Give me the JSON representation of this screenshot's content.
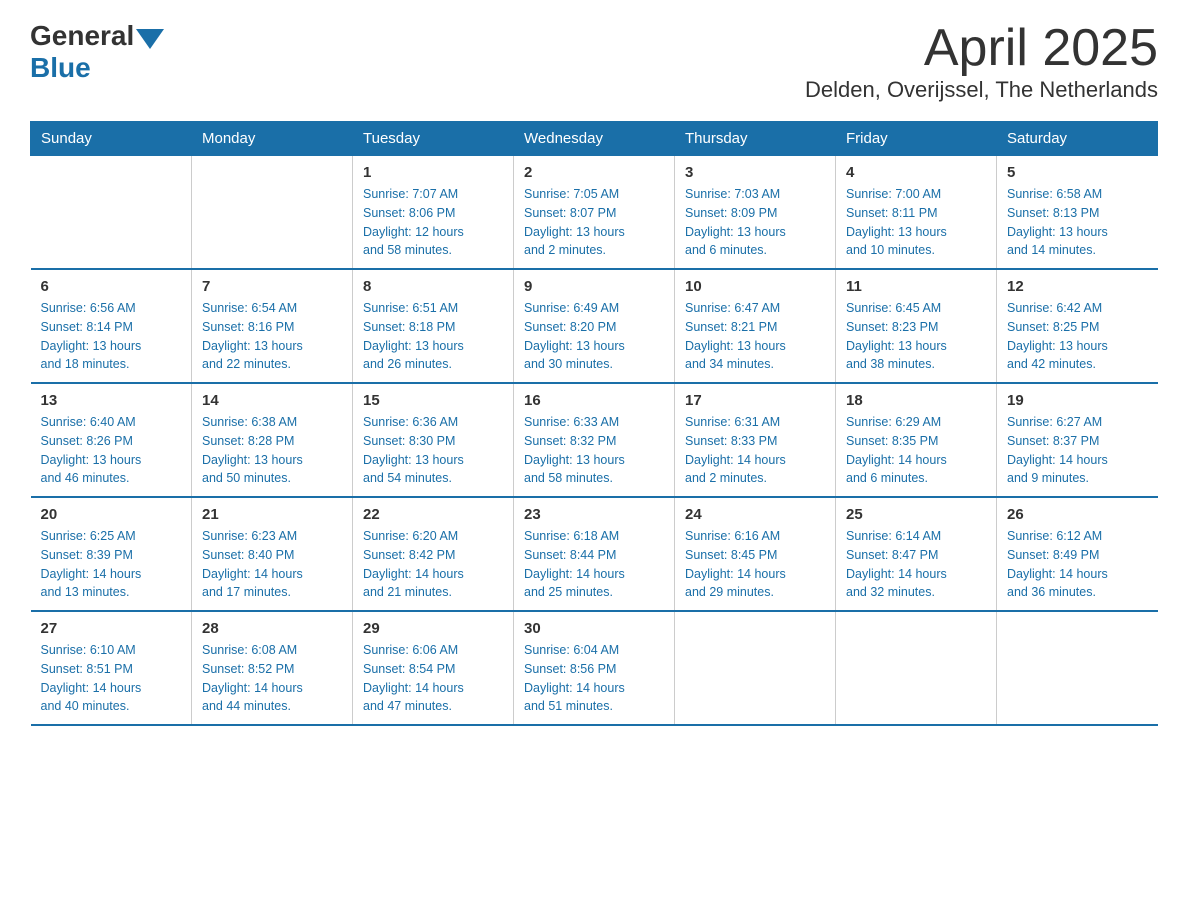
{
  "logo": {
    "general": "General",
    "blue": "Blue"
  },
  "title": "April 2025",
  "subtitle": "Delden, Overijssel, The Netherlands",
  "calendar": {
    "headers": [
      "Sunday",
      "Monday",
      "Tuesday",
      "Wednesday",
      "Thursday",
      "Friday",
      "Saturday"
    ],
    "weeks": [
      [
        {
          "day": "",
          "info": ""
        },
        {
          "day": "",
          "info": ""
        },
        {
          "day": "1",
          "info": "Sunrise: 7:07 AM\nSunset: 8:06 PM\nDaylight: 12 hours\nand 58 minutes."
        },
        {
          "day": "2",
          "info": "Sunrise: 7:05 AM\nSunset: 8:07 PM\nDaylight: 13 hours\nand 2 minutes."
        },
        {
          "day": "3",
          "info": "Sunrise: 7:03 AM\nSunset: 8:09 PM\nDaylight: 13 hours\nand 6 minutes."
        },
        {
          "day": "4",
          "info": "Sunrise: 7:00 AM\nSunset: 8:11 PM\nDaylight: 13 hours\nand 10 minutes."
        },
        {
          "day": "5",
          "info": "Sunrise: 6:58 AM\nSunset: 8:13 PM\nDaylight: 13 hours\nand 14 minutes."
        }
      ],
      [
        {
          "day": "6",
          "info": "Sunrise: 6:56 AM\nSunset: 8:14 PM\nDaylight: 13 hours\nand 18 minutes."
        },
        {
          "day": "7",
          "info": "Sunrise: 6:54 AM\nSunset: 8:16 PM\nDaylight: 13 hours\nand 22 minutes."
        },
        {
          "day": "8",
          "info": "Sunrise: 6:51 AM\nSunset: 8:18 PM\nDaylight: 13 hours\nand 26 minutes."
        },
        {
          "day": "9",
          "info": "Sunrise: 6:49 AM\nSunset: 8:20 PM\nDaylight: 13 hours\nand 30 minutes."
        },
        {
          "day": "10",
          "info": "Sunrise: 6:47 AM\nSunset: 8:21 PM\nDaylight: 13 hours\nand 34 minutes."
        },
        {
          "day": "11",
          "info": "Sunrise: 6:45 AM\nSunset: 8:23 PM\nDaylight: 13 hours\nand 38 minutes."
        },
        {
          "day": "12",
          "info": "Sunrise: 6:42 AM\nSunset: 8:25 PM\nDaylight: 13 hours\nand 42 minutes."
        }
      ],
      [
        {
          "day": "13",
          "info": "Sunrise: 6:40 AM\nSunset: 8:26 PM\nDaylight: 13 hours\nand 46 minutes."
        },
        {
          "day": "14",
          "info": "Sunrise: 6:38 AM\nSunset: 8:28 PM\nDaylight: 13 hours\nand 50 minutes."
        },
        {
          "day": "15",
          "info": "Sunrise: 6:36 AM\nSunset: 8:30 PM\nDaylight: 13 hours\nand 54 minutes."
        },
        {
          "day": "16",
          "info": "Sunrise: 6:33 AM\nSunset: 8:32 PM\nDaylight: 13 hours\nand 58 minutes."
        },
        {
          "day": "17",
          "info": "Sunrise: 6:31 AM\nSunset: 8:33 PM\nDaylight: 14 hours\nand 2 minutes."
        },
        {
          "day": "18",
          "info": "Sunrise: 6:29 AM\nSunset: 8:35 PM\nDaylight: 14 hours\nand 6 minutes."
        },
        {
          "day": "19",
          "info": "Sunrise: 6:27 AM\nSunset: 8:37 PM\nDaylight: 14 hours\nand 9 minutes."
        }
      ],
      [
        {
          "day": "20",
          "info": "Sunrise: 6:25 AM\nSunset: 8:39 PM\nDaylight: 14 hours\nand 13 minutes."
        },
        {
          "day": "21",
          "info": "Sunrise: 6:23 AM\nSunset: 8:40 PM\nDaylight: 14 hours\nand 17 minutes."
        },
        {
          "day": "22",
          "info": "Sunrise: 6:20 AM\nSunset: 8:42 PM\nDaylight: 14 hours\nand 21 minutes."
        },
        {
          "day": "23",
          "info": "Sunrise: 6:18 AM\nSunset: 8:44 PM\nDaylight: 14 hours\nand 25 minutes."
        },
        {
          "day": "24",
          "info": "Sunrise: 6:16 AM\nSunset: 8:45 PM\nDaylight: 14 hours\nand 29 minutes."
        },
        {
          "day": "25",
          "info": "Sunrise: 6:14 AM\nSunset: 8:47 PM\nDaylight: 14 hours\nand 32 minutes."
        },
        {
          "day": "26",
          "info": "Sunrise: 6:12 AM\nSunset: 8:49 PM\nDaylight: 14 hours\nand 36 minutes."
        }
      ],
      [
        {
          "day": "27",
          "info": "Sunrise: 6:10 AM\nSunset: 8:51 PM\nDaylight: 14 hours\nand 40 minutes."
        },
        {
          "day": "28",
          "info": "Sunrise: 6:08 AM\nSunset: 8:52 PM\nDaylight: 14 hours\nand 44 minutes."
        },
        {
          "day": "29",
          "info": "Sunrise: 6:06 AM\nSunset: 8:54 PM\nDaylight: 14 hours\nand 47 minutes."
        },
        {
          "day": "30",
          "info": "Sunrise: 6:04 AM\nSunset: 8:56 PM\nDaylight: 14 hours\nand 51 minutes."
        },
        {
          "day": "",
          "info": ""
        },
        {
          "day": "",
          "info": ""
        },
        {
          "day": "",
          "info": ""
        }
      ]
    ]
  }
}
